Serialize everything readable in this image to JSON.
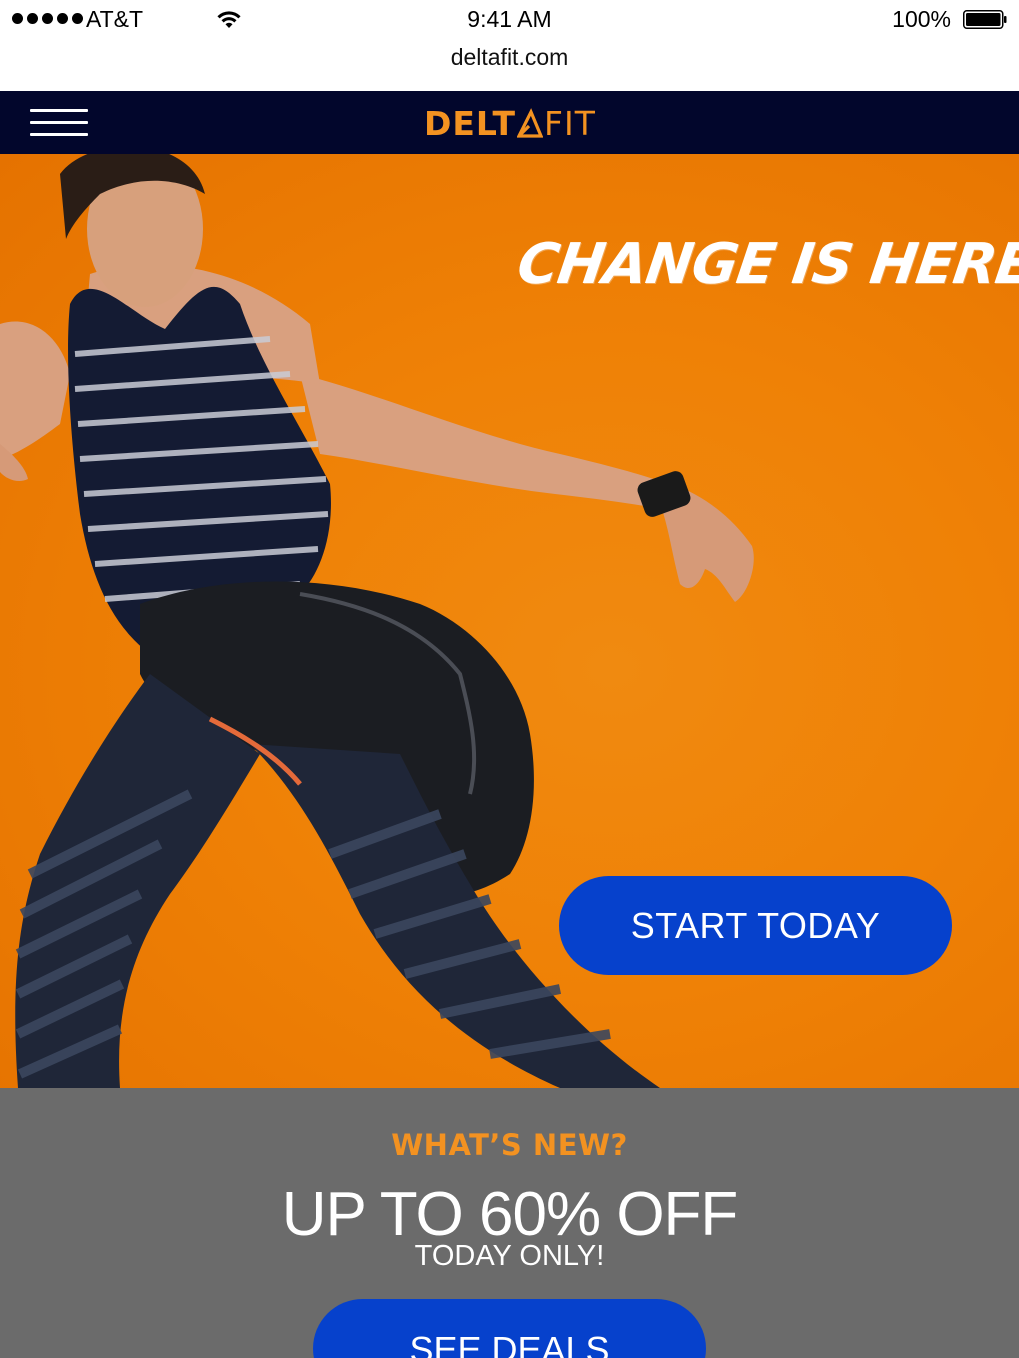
{
  "status_bar": {
    "carrier": "AT&T",
    "time": "9:41 AM",
    "battery_percent": "100%",
    "signal_bars": 5,
    "icons": [
      "signal-dots-icon",
      "wifi-icon",
      "battery-icon"
    ]
  },
  "browser": {
    "url": "deltafit.com"
  },
  "nav": {
    "logo_part1": "DELT",
    "logo_part2": "FIT",
    "icons": [
      "menu-icon",
      "delta-logo-icon"
    ]
  },
  "hero": {
    "headline": "CHANGE IS HERE.",
    "cta_label": "START TODAY"
  },
  "promo": {
    "eyebrow": "WHAT’S NEW?",
    "headline": "UP TO 60% OFF",
    "subline": "TODAY ONLY!",
    "cta_label": "SEE DEALS"
  },
  "colors": {
    "brand_orange": "#f39221",
    "hero_orange": "#ef8106",
    "nav_navy": "#02062c",
    "cta_blue": "#0641cc",
    "promo_gray": "#6b6b6b"
  }
}
